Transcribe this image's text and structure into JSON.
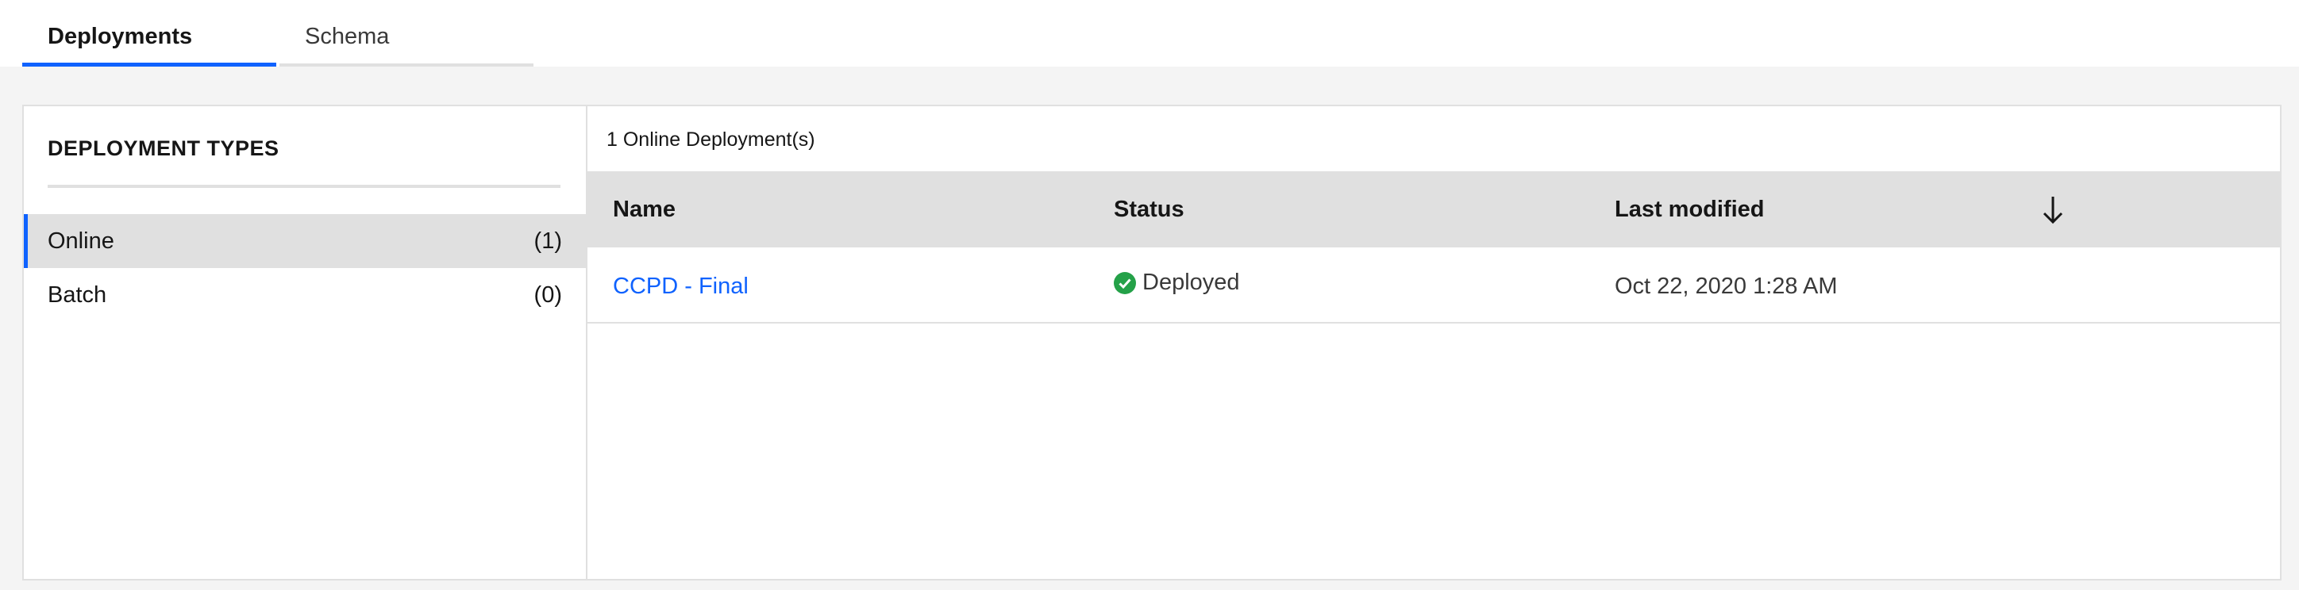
{
  "tabs": [
    {
      "label": "Deployments",
      "active": true
    },
    {
      "label": "Schema",
      "active": false
    }
  ],
  "sidebar": {
    "heading": "DEPLOYMENT TYPES",
    "items": [
      {
        "label": "Online",
        "count": "(1)",
        "selected": true
      },
      {
        "label": "Batch",
        "count": "(0)",
        "selected": false
      }
    ]
  },
  "content": {
    "summary": "1 Online Deployment(s)",
    "columns": [
      "Name",
      "Status",
      "Last modified"
    ],
    "sort_icon": "arrow-down-icon",
    "rows": [
      {
        "name": "CCPD - Final",
        "status": "Deployed",
        "status_icon": "check-circle-icon",
        "last_modified": "Oct 22, 2020 1:28 AM"
      }
    ]
  },
  "colors": {
    "accent": "#0f62fe",
    "success": "#24a148",
    "header_bg": "#e0e0e0",
    "page_bg": "#f4f4f4"
  }
}
